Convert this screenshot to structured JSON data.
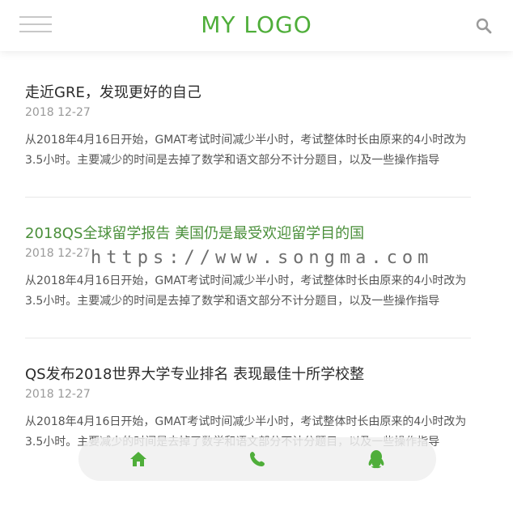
{
  "header": {
    "logo": "MY LOGO",
    "menu_icon": "hamburger-menu-icon",
    "search_icon": "search-icon",
    "accent_color": "#4fae3a"
  },
  "articles": [
    {
      "title": "走近GRE，发现更好的自己",
      "date": "2018 12-27",
      "summary": "从2018年4月16日开始，GMAT考试时间减少半小时，考试整体时长由原来的4小时改为3.5小时。主要减少的时间是去掉了数学和语文部分不计分题目，以及一些操作指导"
    },
    {
      "title": "2018QS全球留学报告 美国仍是最受欢迎留学目的国",
      "date": "2018 12-27",
      "summary": "从2018年4月16日开始，GMAT考试时间减少半小时，考试整体时长由原来的4小时改为3.5小时。主要减少的时间是去掉了数学和语文部分不计分题目，以及一些操作指导"
    },
    {
      "title": "QS发布2018世界大学专业排名 表现最佳十所学校整",
      "date": "2018 12-27",
      "summary": "从2018年4月16日开始，GMAT考试时间减少半小时，考试整体时长由原来的4小时改为3.5小时。主要减少的时间是去掉了数学和语文部分不计分题目，以及一些操作指导"
    }
  ],
  "watermark": "https://www.songma.com",
  "bottom_bar": {
    "icons": [
      "home-icon",
      "phone-icon",
      "qq-icon"
    ],
    "icon_color": "#4fae3a"
  }
}
